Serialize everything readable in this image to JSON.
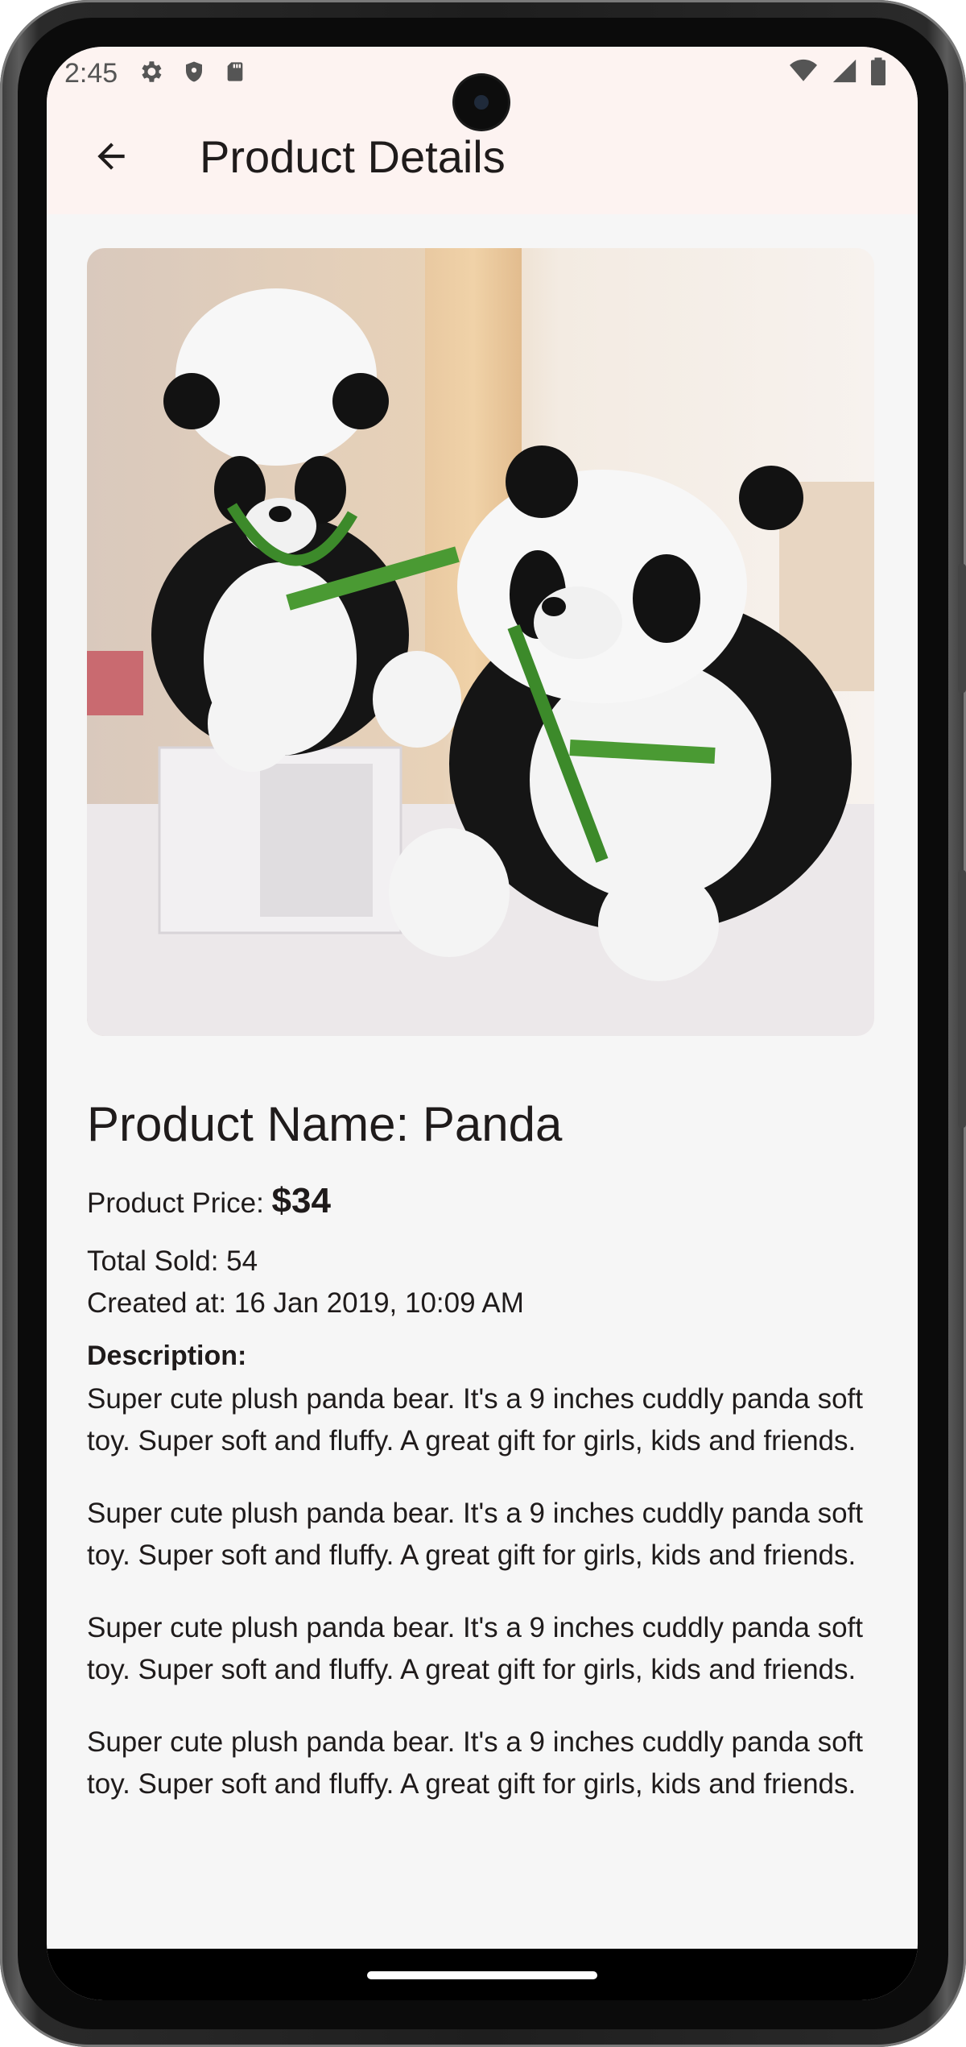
{
  "status_bar": {
    "time": "2:45",
    "left_icons": [
      "gear-icon",
      "shield-icon",
      "sd-card-icon"
    ],
    "right_icons": [
      "wifi-icon",
      "signal-icon",
      "battery-icon"
    ]
  },
  "app_bar": {
    "title": "Product Details",
    "back_icon": "arrow-back-icon"
  },
  "product": {
    "image_alt": "Two panda plush toys holding bamboo leaves",
    "name": "Product Name: Panda",
    "price_label": "Product Price: ",
    "price_value": "$34",
    "total_sold": "Total Sold: 54",
    "created_at": "Created at: 16 Jan 2019, 10:09 AM",
    "description_label": "Description:",
    "description_paragraphs": [
      "Super cute plush panda bear. It's a 9 inches cuddly panda soft toy. Super soft and fluffy. A great gift for girls, kids and friends.",
      "Super cute plush panda bear. It's a 9 inches cuddly panda soft toy. Super soft and fluffy. A great gift for girls, kids and friends.",
      "Super cute plush panda bear. It's a 9 inches cuddly panda soft toy. Super soft and fluffy. A great gift for girls, kids and friends.",
      "Super cute plush panda bear. It's a 9 inches cuddly panda soft toy. Super soft and fluffy. A great gift for girls, kids and friends."
    ]
  },
  "colors": {
    "app_bar_bg": "#fdf3f1",
    "page_bg": "#f6f6f6",
    "text": "#1f1b1b"
  }
}
